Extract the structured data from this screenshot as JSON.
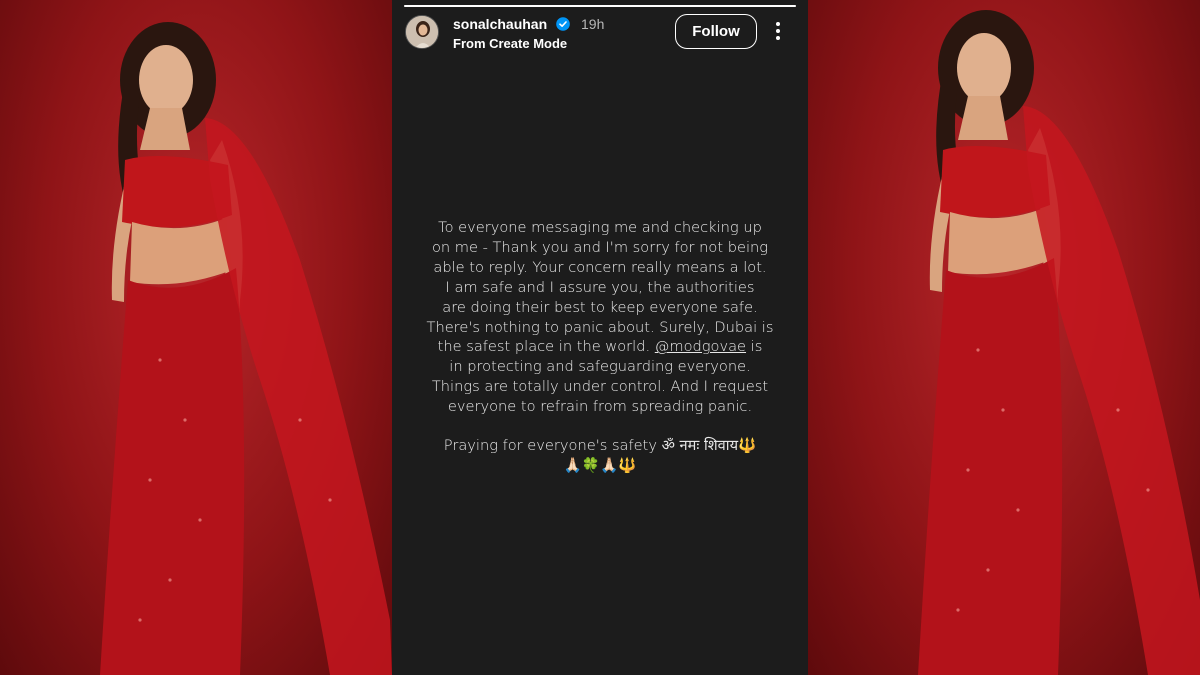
{
  "story": {
    "username": "sonalchauhan",
    "time": "19h",
    "subtitle": "From Create Mode",
    "follow_label": "Follow",
    "lines": [
      "To everyone messaging me and checking up",
      "on me - Thank you and I'm sorry for not being",
      "able to reply. Your concern really means a lot.",
      "I am safe and I assure you, the authorities",
      "are doing their best to keep everyone safe.",
      "There's nothing to panic about. Surely, Dubai is",
      "the safest place in the world."
    ],
    "mention": "@modgovae",
    "line7_suffix": " is",
    "lines_after": [
      "in protecting and safeguarding everyone.",
      "Things are totally under control. And I request",
      "everyone  to refrain from spreading panic."
    ],
    "prayer_line": "Praying for everyone's safety ॐ नमः शिवाय",
    "trident": "🔱",
    "emoji_line": "🙏🏻🍀🙏🏻🔱",
    "progress": 1.0
  },
  "colors": {
    "story_bg": "#1c1c1c",
    "photo_red": "#b8262a",
    "verified_blue": "#0095f6"
  }
}
